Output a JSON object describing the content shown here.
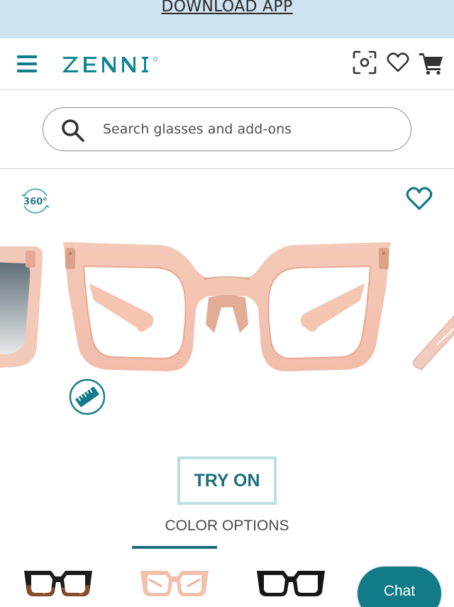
{
  "promo": {
    "link_text": "DOWNLOAD APP"
  },
  "header": {
    "logo_text": "ZENNI",
    "icons": [
      "menu-icon",
      "face-scan-icon",
      "heart-icon",
      "cart-icon"
    ]
  },
  "search": {
    "placeholder": "Search glasses and add-ons"
  },
  "gallery": {
    "badge_360": "360°",
    "icons": [
      "heart-icon",
      "ruler-icon"
    ],
    "frame_color": "#f0b6a1"
  },
  "try_on": {
    "label": "TRY ON"
  },
  "color_options": {
    "title": "COLOR OPTIONS",
    "selected_index": 1,
    "swatches": [
      "black-tortoise",
      "pink",
      "black"
    ]
  },
  "chat": {
    "label": "Chat"
  },
  "colors": {
    "accent": "#137a87",
    "promo_bg": "#cfe2f0",
    "tryon_border": "#bcdfe3"
  }
}
